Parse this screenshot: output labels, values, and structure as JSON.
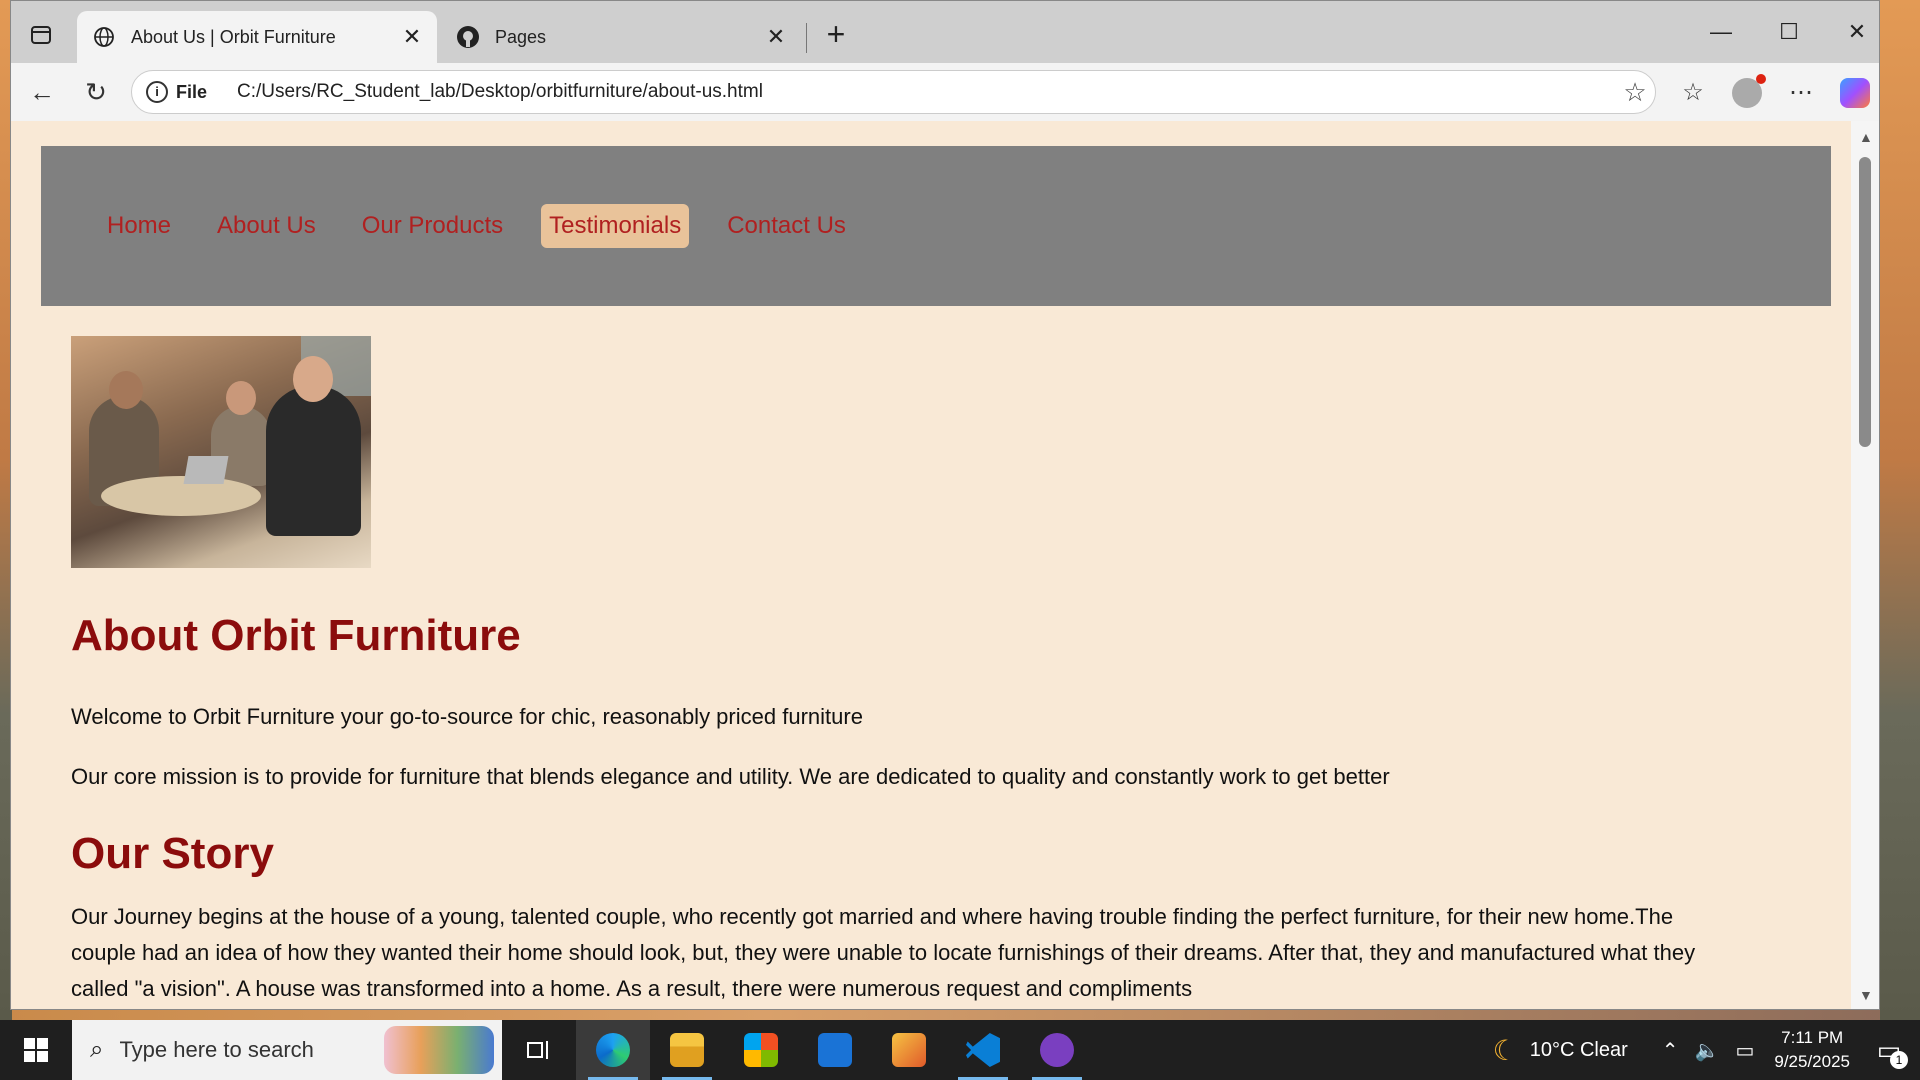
{
  "browser": {
    "tabs": [
      {
        "title": "About Us | Orbit Furniture",
        "icon": "globe-icon",
        "active": true
      },
      {
        "title": "Pages",
        "icon": "github-icon",
        "active": false
      }
    ],
    "address": {
      "file_label": "File",
      "url": "C:/Users/RC_Student_lab/Desktop/orbitfurniture/about-us.html"
    }
  },
  "site": {
    "nav": [
      "Home",
      "About Us",
      "Our Products",
      "Testimonials",
      "Contact Us"
    ],
    "active_nav": "Testimonials",
    "about_title": "About Orbit Furniture",
    "intro": "Welcome to Orbit Furniture your go-to-source for chic, reasonably priced furniture",
    "mission": "Our core mission is to provide for furniture that blends elegance and utility. We are dedicated to quality and constantly work to get better",
    "story_title": "Our Story",
    "story": "Our Journey begins at the house of a young, talented couple, who recently got married and where having trouble finding the perfect furniture, for their new home.The couple had an idea of how they wanted their home should look, but, they were unable to locate furnishings of their dreams. After that, they and manufactured what they called \"a vision\". A house was transformed into a home. As a result, there were numerous request and compliments"
  },
  "taskbar": {
    "search_placeholder": "Type here to search",
    "weather": "10°C  Clear",
    "time": "7:11 PM",
    "date": "9/25/2025",
    "notification_count": "1"
  },
  "colors": {
    "page_bg": "#f9e9d6",
    "nav_bg": "#808080",
    "nav_link": "#b02020",
    "nav_active_bg": "#e9c39a",
    "heading": "#8b0c0c"
  }
}
